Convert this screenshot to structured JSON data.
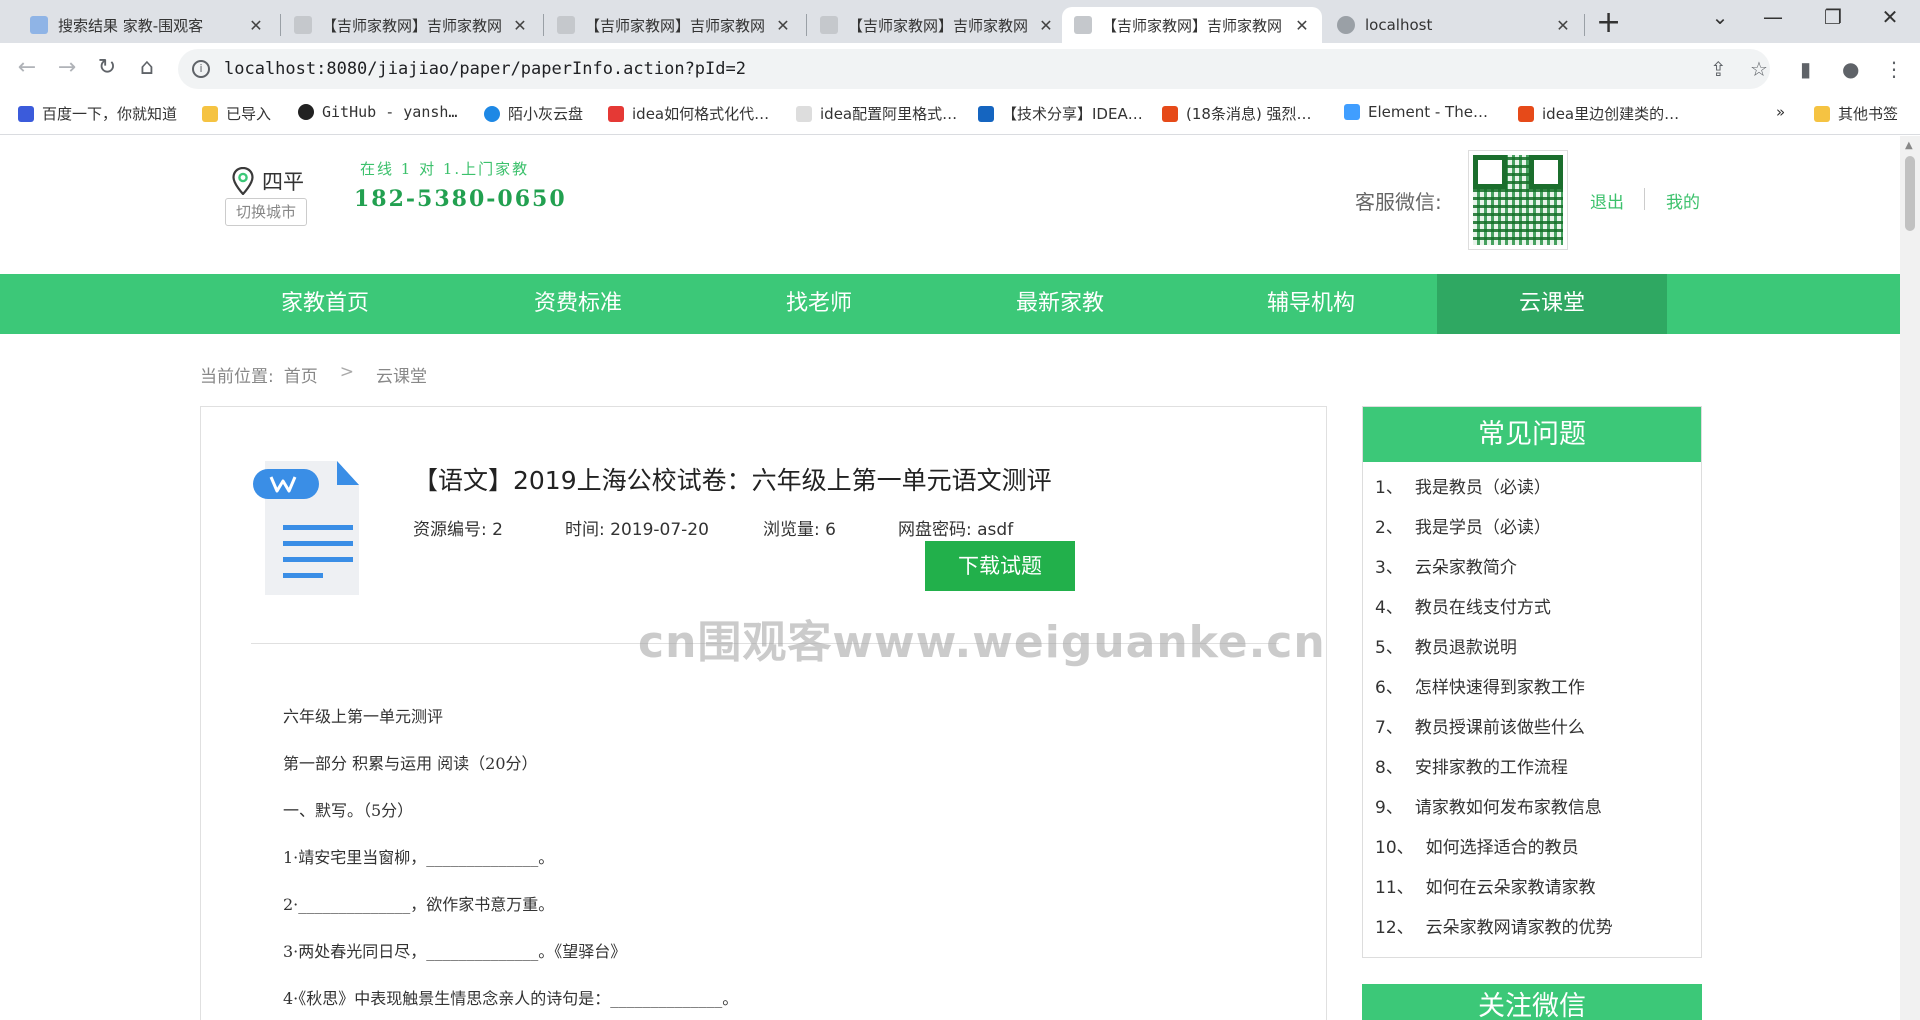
{
  "browser": {
    "tabs": [
      {
        "title": "搜索结果 家教-围观客",
        "close": "✕"
      },
      {
        "title": "【吉师家教网】吉师家教网",
        "close": "✕"
      },
      {
        "title": "【吉师家教网】吉师家教网",
        "close": "✕"
      },
      {
        "title": "【吉师家教网】吉师家教网",
        "close": "✕"
      },
      {
        "title": "【吉师家教网】吉师家教网",
        "close": "✕"
      },
      {
        "title": "localhost",
        "close": "✕"
      }
    ],
    "new_tab": "+",
    "controls": {
      "dropdown": "⌄",
      "minimize": "—",
      "restore": "❐",
      "close": "✕"
    },
    "nav": {
      "back": "←",
      "forward": "→",
      "reload": "↻",
      "home": "⌂"
    },
    "url": "localhost:8080/jiajiao/paper/paperInfo.action?pId=2",
    "url_icons": {
      "share": "⇪",
      "star": "☆",
      "sidebar": "▮",
      "profile": "●",
      "menu": "⋮"
    },
    "bookmarks": [
      {
        "label": "百度一下，你就知道",
        "color": "#3b5bdb"
      },
      {
        "label": "已导入",
        "color": "#f5c342"
      },
      {
        "label": "GitHub - yansh…",
        "color": "#222222"
      },
      {
        "label": "陌小灰云盘",
        "color": "#1e88e5"
      },
      {
        "label": "idea如何格式化代…",
        "color": "#e53935"
      },
      {
        "label": "idea配置阿里格式…",
        "color": "#cccccc"
      },
      {
        "label": "【技术分享】IDEA…",
        "color": "#1565c0"
      },
      {
        "label": "(18条消息) 强烈…",
        "color": "#e64a19"
      },
      {
        "label": "Element - The…",
        "color": "#409eff"
      },
      {
        "label": "idea里边创建类的…",
        "color": "#e64a19"
      }
    ],
    "bookmarks_more": "»",
    "other_bookmarks": "其他书签"
  },
  "header": {
    "city": "四平",
    "switch_city": "切换城市",
    "slogan": "在线 1 对 1.上门家教",
    "phone": "182-5380-0650",
    "wechat_label": "客服微信:",
    "logout": "退出",
    "mine": "我的"
  },
  "nav": [
    "家教首页",
    "资费标准",
    "找老师",
    "最新家教",
    "辅导机构",
    "云课堂"
  ],
  "breadcrumb": {
    "label": "当前位置:",
    "home": "首页",
    "sep": ">",
    "current": "云课堂"
  },
  "paper": {
    "title": "【语文】2019上海公校试卷：六年级上第一单元语文测评",
    "id_label": "资源编号: 2",
    "time_label": "时间: 2019-07-20",
    "views_label": "浏览量: 6",
    "password_label": "网盘密码: asdf",
    "download": "下载试题",
    "content": [
      "六年级上第一单元测评",
      "第一部分  积累与运用 阅读（20分）",
      "一、默写。（5分）",
      "1·靖安宅里当窗柳，______________。",
      "2·______________，欲作家书意万重。",
      "3·两处春光同日尽，______________。《望驿台》",
      "4·《秋思》中表现触景生情思念亲人的诗句是：______________。"
    ]
  },
  "faq": {
    "title": "常见问题",
    "items": [
      {
        "num": "1、",
        "text": "我是教员（必读）"
      },
      {
        "num": "2、",
        "text": "我是学员（必读）"
      },
      {
        "num": "3、",
        "text": "云朵家教简介"
      },
      {
        "num": "4、",
        "text": "教员在线支付方式"
      },
      {
        "num": "5、",
        "text": "教员退款说明"
      },
      {
        "num": "6、",
        "text": "怎样快速得到家教工作"
      },
      {
        "num": "7、",
        "text": "教员授课前该做些什么"
      },
      {
        "num": "8、",
        "text": "安排家教的工作流程"
      },
      {
        "num": "9、",
        "text": "请家教如何发布家教信息"
      },
      {
        "num": "10、",
        "text": "如何选择适合的教员"
      },
      {
        "num": "11、",
        "text": "如何在云朵家教请家教"
      },
      {
        "num": "12、",
        "text": "云朵家教网请家教的优势"
      }
    ]
  },
  "follow": {
    "title": "关注微信"
  },
  "watermark": "cn围观客www.weiguanke.cn",
  "colors": {
    "brand_green": "#3cc878",
    "nav_active": "#2fa862",
    "button_green": "#22b04b"
  }
}
